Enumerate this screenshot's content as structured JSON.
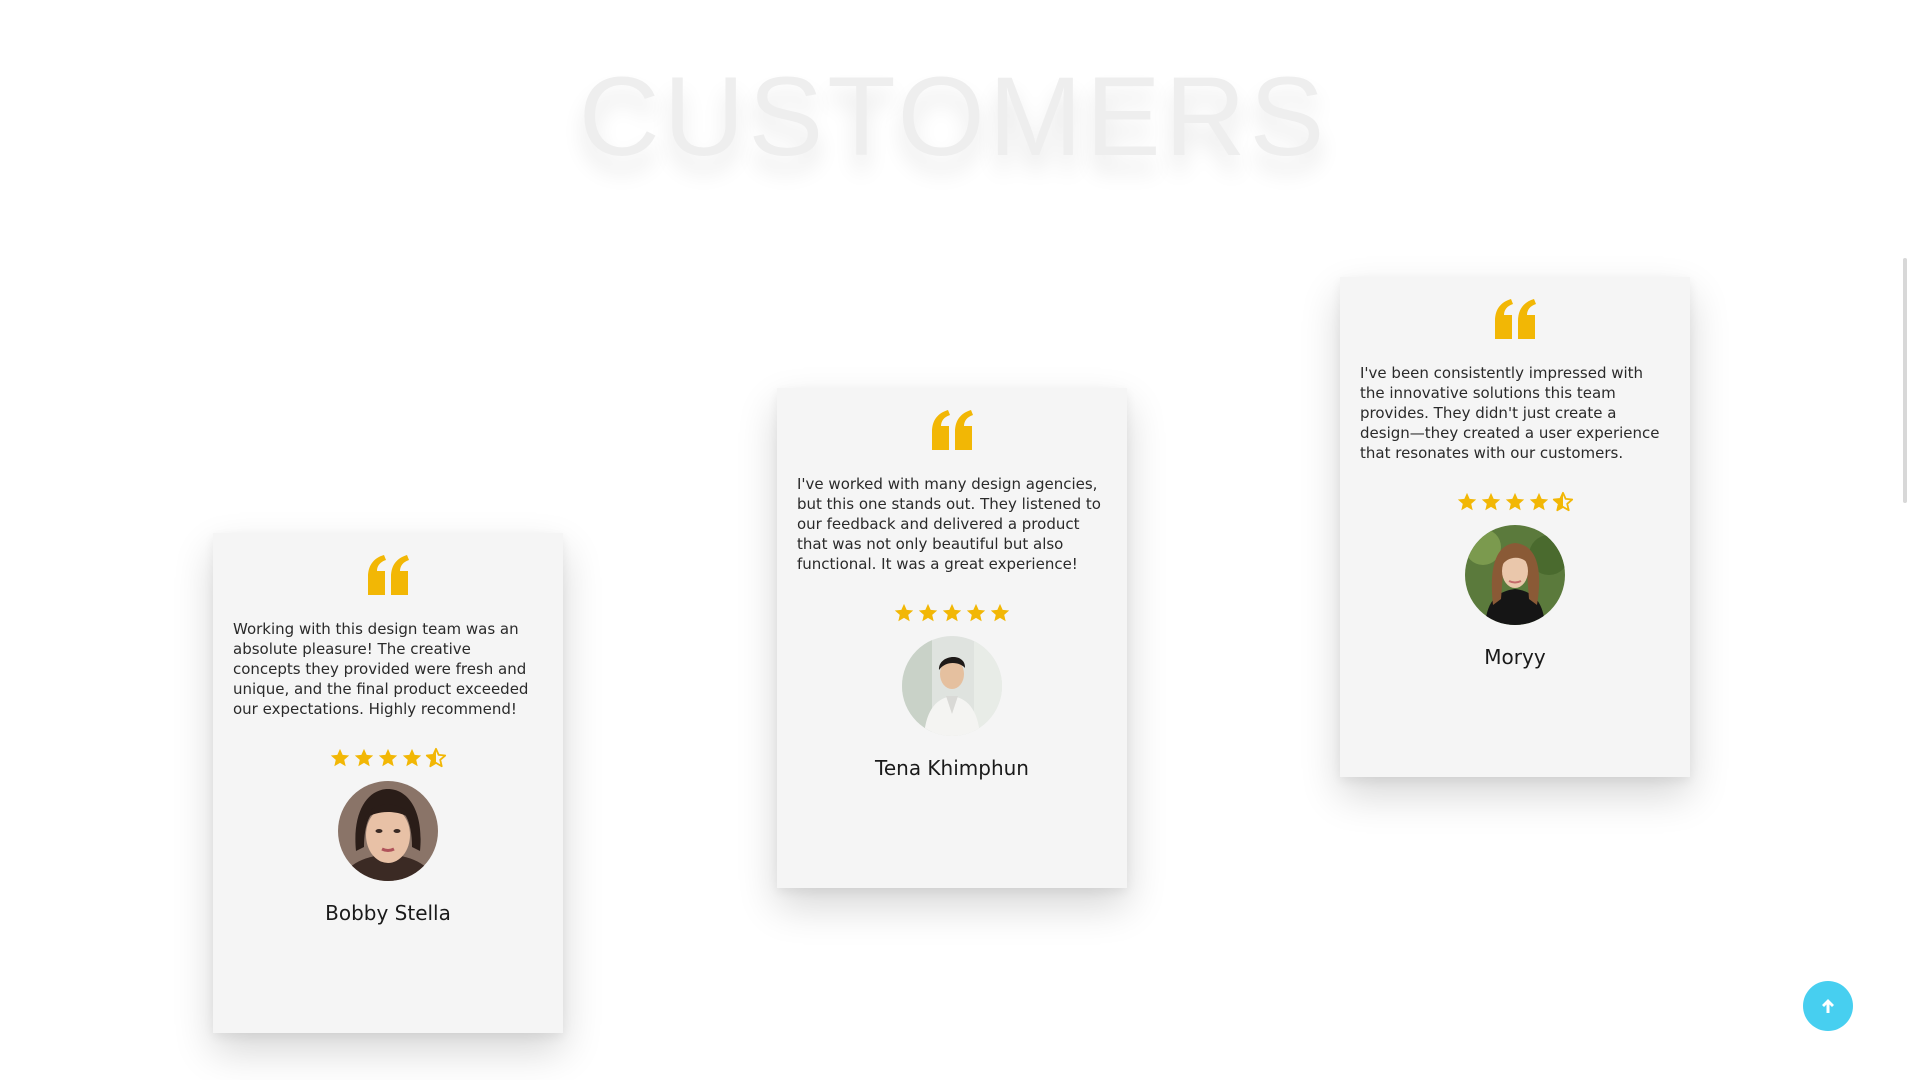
{
  "section": {
    "title": "CUSTOMERS"
  },
  "colors": {
    "accent": "#f2b705",
    "card_background": "#f5f5f5",
    "back_to_top": "#47cff0"
  },
  "testimonials": [
    {
      "quote_icon": "quote-icon",
      "text": "Working with this design team was an absolute pleasure! The creative concepts they provided were fresh and unique, and the final product exceeded our expectations. Highly recommend!",
      "rating": 4.5,
      "name": "Bobby Stella"
    },
    {
      "quote_icon": "quote-icon",
      "text": "I've worked with many design agencies, but this one stands out. They listened to our feedback and delivered a product that was not only beautiful but also functional. It was a great experience!",
      "rating": 5,
      "name": "Tena Khimphun"
    },
    {
      "quote_icon": "quote-icon",
      "text": "I've been consistently impressed with the innovative solutions this team provides. They didn't just create a design—they created a user experience that resonates with our customers.",
      "rating": 4.5,
      "name": "Moryy"
    }
  ],
  "back_to_top": {
    "icon": "arrow-up-icon"
  }
}
